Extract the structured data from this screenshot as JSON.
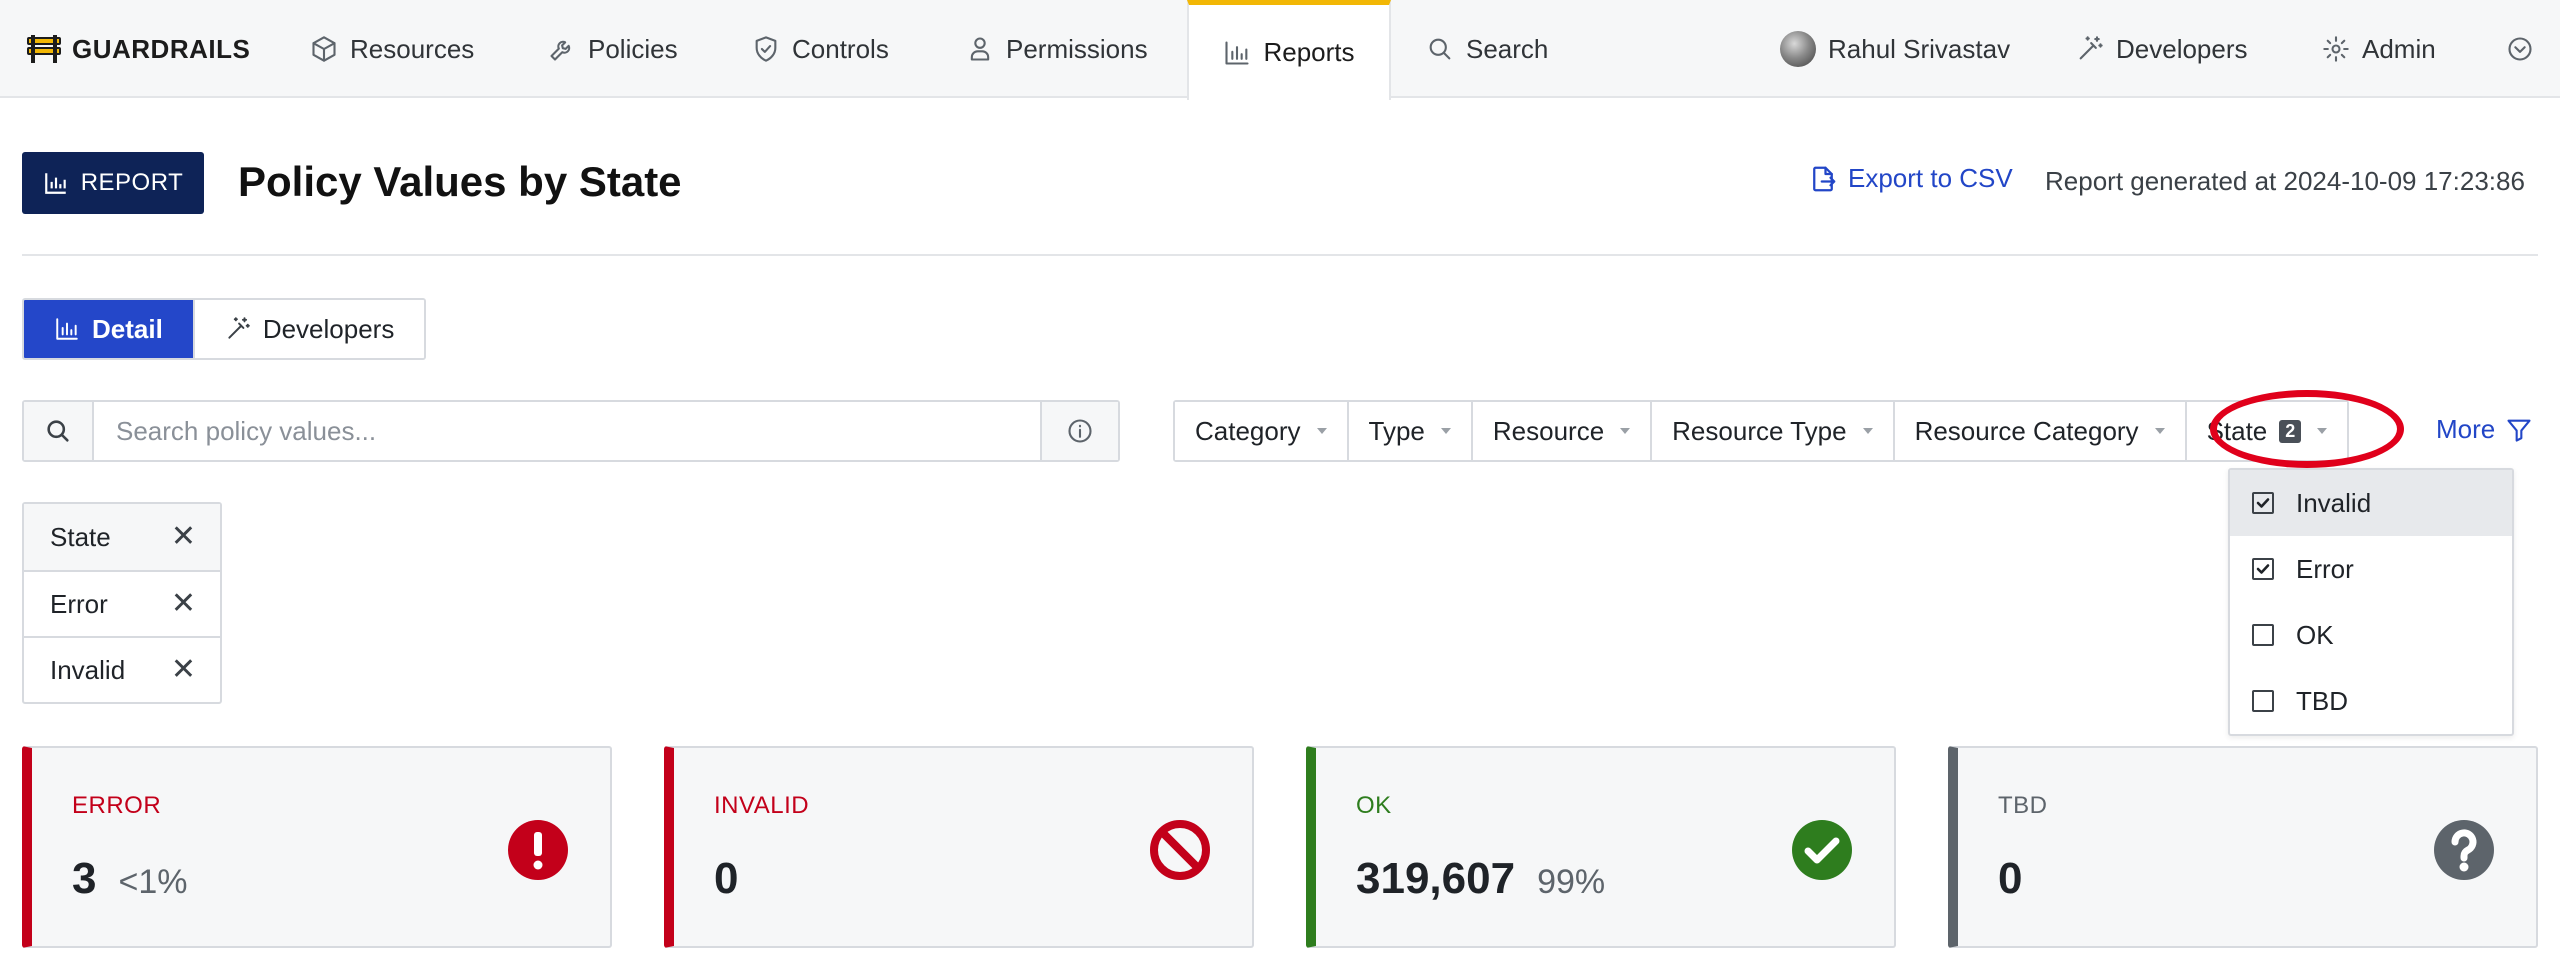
{
  "brand": {
    "name": "GUARDRAILS",
    "logo_icon": "guardrails-logo-icon"
  },
  "nav": {
    "items": [
      {
        "label": "Resources",
        "icon": "cube-icon"
      },
      {
        "label": "Policies",
        "icon": "wrench-icon"
      },
      {
        "label": "Controls",
        "icon": "shield-check-icon"
      },
      {
        "label": "Permissions",
        "icon": "user-badge-icon"
      },
      {
        "label": "Reports",
        "icon": "bar-chart-icon",
        "active": true
      },
      {
        "label": "Search",
        "icon": "search-icon"
      }
    ],
    "user": "Rahul Srivastav",
    "developers": "Developers",
    "admin": "Admin",
    "accent_color": "#f2b705"
  },
  "header": {
    "badge": "REPORT",
    "title": "Policy Values by State",
    "export_label": "Export to CSV",
    "generated": "Report generated at 2024-10-09 17:23:86"
  },
  "view_tabs": [
    {
      "label": "Detail",
      "active": true
    },
    {
      "label": "Developers",
      "active": false
    }
  ],
  "search": {
    "placeholder": "Search policy values..."
  },
  "filters": {
    "items": [
      "Category",
      "Type",
      "Resource",
      "Resource Type",
      "Resource Category"
    ],
    "state_label": "State",
    "state_count": "2",
    "more_label": "More"
  },
  "state_dropdown": {
    "options": [
      {
        "label": "Invalid",
        "checked": true
      },
      {
        "label": "Error",
        "checked": true
      },
      {
        "label": "OK",
        "checked": false
      },
      {
        "label": "TBD",
        "checked": false
      }
    ]
  },
  "active_filters": {
    "header": "State",
    "values": [
      "Error",
      "Invalid"
    ]
  },
  "summary": {
    "error": {
      "label": "ERROR",
      "value": "3",
      "pct": "<1%",
      "color": "#c3001a",
      "icon": "exclamation-circle-icon"
    },
    "invalid": {
      "label": "INVALID",
      "value": "0",
      "pct": "",
      "color": "#c3001a",
      "icon": "ban-icon"
    },
    "ok": {
      "label": "OK",
      "value": "319,607",
      "pct": "99%",
      "color": "#2e7d1e",
      "icon": "check-circle-icon"
    },
    "tbd": {
      "label": "TBD",
      "value": "0",
      "pct": "",
      "color": "#5d646b",
      "icon": "question-circle-icon"
    }
  }
}
